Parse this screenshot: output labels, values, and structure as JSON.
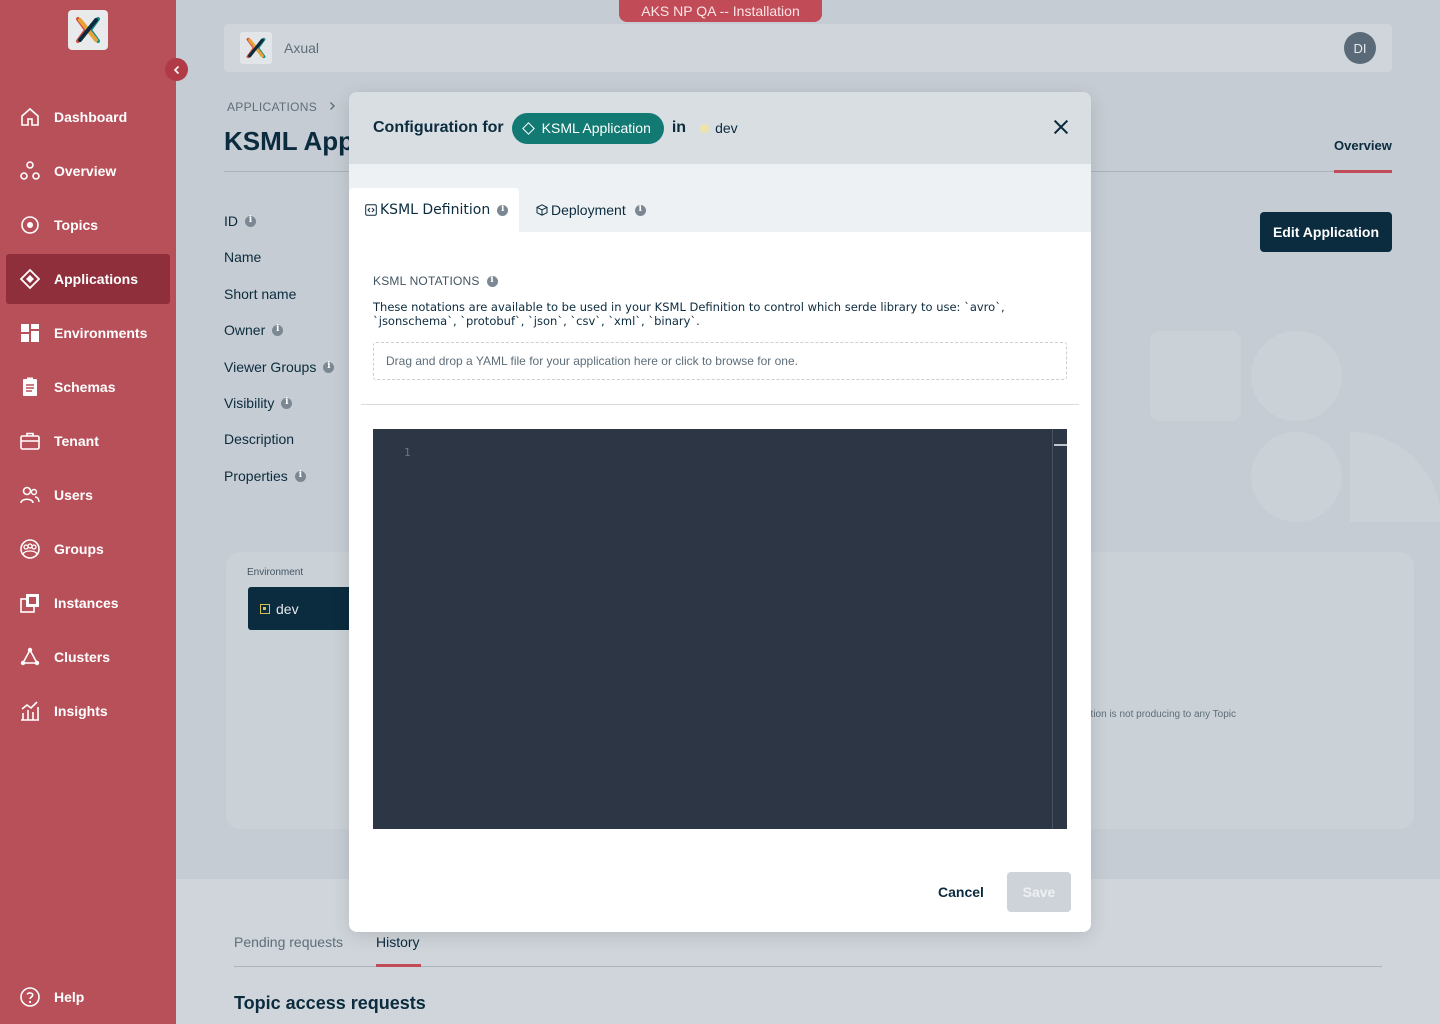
{
  "banner": "AKS NP QA -- Installation",
  "sidebar": {
    "items": [
      {
        "label": "Dashboard",
        "icon": "home-icon"
      },
      {
        "label": "Overview",
        "icon": "overview-icon"
      },
      {
        "label": "Topics",
        "icon": "topics-icon"
      },
      {
        "label": "Applications",
        "icon": "applications-icon",
        "active": true
      },
      {
        "label": "Environments",
        "icon": "environments-icon"
      },
      {
        "label": "Schemas",
        "icon": "schemas-icon"
      },
      {
        "label": "Tenant",
        "icon": "tenant-icon"
      },
      {
        "label": "Users",
        "icon": "users-icon"
      },
      {
        "label": "Groups",
        "icon": "groups-icon"
      },
      {
        "label": "Instances",
        "icon": "instances-icon"
      },
      {
        "label": "Clusters",
        "icon": "clusters-icon"
      },
      {
        "label": "Insights",
        "icon": "insights-icon"
      }
    ],
    "help": "Help"
  },
  "header": {
    "org": "Axual",
    "avatar": "DI"
  },
  "breadcrumb": "APPLICATIONS",
  "page": {
    "title": "KSML Appli",
    "overview_tab": "Overview",
    "edit_button": "Edit Application",
    "fields": [
      "ID",
      "Name",
      "Short name",
      "Owner",
      "Viewer Groups",
      "Visibility",
      "Description",
      "Properties"
    ]
  },
  "environment_card": {
    "label": "Environment",
    "dev": "dev",
    "not_producing": "ation is not producing to any Topic"
  },
  "requests": {
    "pending_tab": "Pending requests",
    "history_tab": "History",
    "topic_access": "Topic access requests"
  },
  "modal": {
    "title_prefix": "Configuration for",
    "app_pill": "KSML Application",
    "in_word": "in",
    "env": "dev",
    "tabs": [
      {
        "label": "KSML Definition",
        "active": true
      },
      {
        "label": "Deployment",
        "active": false
      }
    ],
    "notations_title": "KSML NOTATIONS",
    "notations_desc": "These notations are available to be used in your KSML Definition to control which serde library to use: `avro`, `jsonschema`, `protobuf`, `json`, `csv`, `xml`, `binary`.",
    "dropzone": "Drag and drop a YAML file for your application here or click to browse for one.",
    "editor_line": "1",
    "cancel": "Cancel",
    "save": "Save"
  },
  "colors": {
    "sidebar": "#b8505a",
    "sidebar_active": "#8f2f3b",
    "accent_red": "#c14b57",
    "primary_dark": "#0b2b3e",
    "teal": "#127a73",
    "editor_bg": "#2c3644"
  }
}
